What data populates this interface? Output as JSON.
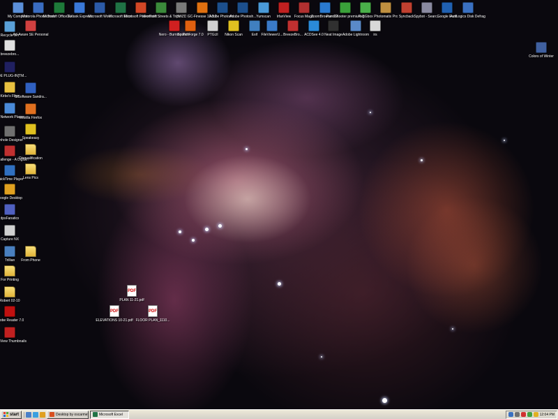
{
  "desktop": {
    "top_row": [
      {
        "name": "icon-my-computer",
        "label": "My Computer",
        "color": "#5b8fd8"
      },
      {
        "name": "icon-motorola-phone-tools",
        "label": "Motorola Phone Tools",
        "color": "#3a6cc0"
      },
      {
        "name": "icon-office-excel-1",
        "label": "Microsoft Office Ex...",
        "color": "#1e7a3a"
      },
      {
        "name": "icon-outlook-express",
        "label": "Outlook Express",
        "color": "#3a78d8"
      },
      {
        "name": "icon-ms-word",
        "label": "Microsoft Word",
        "color": "#2c5aa8"
      },
      {
        "name": "icon-ms-excel",
        "label": "Microsoft Excel",
        "color": "#207245"
      },
      {
        "name": "icon-ms-powerpoint",
        "label": "Microsoft PowerPoint",
        "color": "#d24726"
      },
      {
        "name": "icon-ms-streets-trips",
        "label": "Microsoft Streets & Trips",
        "color": "#3b8a3b"
      },
      {
        "name": "icon-3wzd",
        "label": "3WZD",
        "color": "#7a7a7a"
      },
      {
        "name": "icon-gc-finesse",
        "label": "GC-Finesse 13.2.2",
        "color": "#e07010"
      },
      {
        "name": "icon-adobe-photoshop-1",
        "label": "Adobe Photosh...",
        "color": "#1c4f8c"
      },
      {
        "name": "icon-adobe-photoshop-2",
        "label": "Adobe Photosh...",
        "color": "#1c4f8c"
      },
      {
        "name": "icon-yumscan",
        "label": "Yumscan",
        "color": "#4a9ad8"
      },
      {
        "name": "icon-irfanview",
        "label": "IrfanView",
        "color": "#c02020"
      },
      {
        "name": "icon-focus-magic",
        "label": "Focus Magic",
        "color": "#b03030"
      },
      {
        "name": "icon-zoombrowser",
        "label": "ZoomBrowser EX",
        "color": "#2a7ad0"
      },
      {
        "name": "icon-panoshooter",
        "label": "PanoShooter premium 2006",
        "color": "#3aa03a"
      },
      {
        "name": "icon-regcleaner",
        "label": "RegGbox",
        "color": "#4ab04a"
      },
      {
        "name": "icon-photomatix",
        "label": "Photomatix Pro",
        "color": "#c09040"
      },
      {
        "name": "icon-syncback",
        "label": "Syncback",
        "color": "#c04030"
      },
      {
        "name": "icon-spybot",
        "label": "Spybot - Searc...",
        "color": "#8a8aa0"
      },
      {
        "name": "icon-google-earth",
        "label": "Google Earth",
        "color": "#2060b0"
      },
      {
        "name": "icon-auslogics-defrag",
        "label": "AusLogics Disk Defrag",
        "color": "#3a70c0"
      }
    ],
    "second_row": [
      {
        "name": "icon-nero-burning-rom",
        "label": "Nero - Burning Rom",
        "color": "#d02020"
      },
      {
        "name": "icon-sound-forge",
        "label": "Sound Forge 7.0",
        "color": "#e06010"
      },
      {
        "name": "icon-ptgui",
        "label": "PTGUI",
        "color": "#d0d0d0"
      },
      {
        "name": "icon-nikon-scan",
        "label": "Nikon Scan",
        "color": "#e0c020"
      },
      {
        "name": "icon-exif",
        "label": "Exif",
        "color": "#4080c0"
      },
      {
        "name": "icon-fileviewer",
        "label": "FileViewerU...",
        "color": "#3a7ac8"
      },
      {
        "name": "icon-breezebrowser",
        "label": "BreezeBro...",
        "color": "#c03030"
      },
      {
        "name": "icon-acdsee",
        "label": "ACDSee 4.0",
        "color": "#2a8ad8"
      },
      {
        "name": "icon-neat-image",
        "label": "Neat Image",
        "color": "#303030"
      },
      {
        "name": "icon-adobe-lightroom",
        "label": "Adobe Lightroom",
        "color": "#5a8ac8"
      },
      {
        "name": "icon-irs",
        "label": "irs",
        "color": "#d8d8d8"
      }
    ],
    "left_column_a": [
      {
        "name": "icon-recycle-bin",
        "label": "Recycle Bin",
        "color": "#5aa0d8"
      },
      {
        "name": "icon-breezebro-left",
        "label": "breezebro...",
        "color": "#e0e0e0"
      },
      {
        "name": "icon-slide-plugin",
        "label": "SLIDE PLUG-IN[TM...",
        "color": "#202060"
      },
      {
        "name": "icon-kirbys-files",
        "label": "Kirbo's Files",
        "color": "#e8c040"
      },
      {
        "name": "icon-my-network-places",
        "label": "My Network Places",
        "color": "#4a8ad8"
      },
      {
        "name": "icon-pinhole-designer",
        "label": "Pinhole Designer",
        "color": "#707070"
      },
      {
        "name": "icon-dpchallenge",
        "label": "DPChallenge - A Digital Ph...",
        "color": "#c03030"
      },
      {
        "name": "icon-quicktime",
        "label": "QuickTime Player",
        "color": "#3070c0"
      },
      {
        "name": "icon-google-desktop",
        "label": "Google Desktop",
        "color": "#e0a020"
      },
      {
        "name": "icon-dpsfanatics",
        "label": "dpsFanatics",
        "color": "#5060c0"
      },
      {
        "name": "icon-capture-nx",
        "label": "Capture NX",
        "color": "#d0d0d0"
      },
      {
        "name": "icon-trillian",
        "label": "Trillian",
        "color": "#4a80c0"
      },
      {
        "name": "icon-for-printing",
        "label": "For Printing",
        "folder": true
      },
      {
        "name": "icon-robert",
        "label": "Robert 02-10",
        "folder": true
      },
      {
        "name": "icon-adobe-reader",
        "label": "Adobe Reader 7.0",
        "color": "#c01010"
      },
      {
        "name": "icon-irfanview-thumbnails",
        "label": "IrfanView Thumbnails",
        "color": "#c02020"
      }
    ],
    "left_column_b": [
      {
        "name": "icon-adaware",
        "label": "Ad-Aware SE Personal",
        "color": "#d04040"
      },
      {
        "name": "icon-sisoftware-sandra",
        "label": "SiSoftware Sandra...",
        "color": "#3060c0"
      },
      {
        "name": "icon-mozilla-firefox",
        "label": "Mozilla Firefox",
        "color": "#e07020"
      },
      {
        "name": "icon-speakeasy",
        "label": "Speakeasy",
        "color": "#e0c020"
      },
      {
        "name": "icon-disqualification",
        "label": "Disqualification",
        "folder": true
      },
      {
        "name": "icon-lens-pics",
        "label": "Lens Pics",
        "folder": true
      },
      {
        "name": "icon-from-phone",
        "label": "From Phone",
        "folder": true
      }
    ],
    "right_icon": {
      "name": "icon-colors-of-winter",
      "label": "Colors of Winter",
      "color": "#4060a0"
    },
    "pdf_files": [
      {
        "name": "pdf-plan",
        "label": "PLAN 11-21.pdf",
        "badge": "PDF"
      },
      {
        "name": "pdf-elevations",
        "label": "ELEVATIONS 10-21.pdf",
        "badge": "PDF"
      },
      {
        "name": "pdf-floor-plan",
        "label": "FLOOR PLAN_1110...",
        "badge": "PDF"
      }
    ]
  },
  "taskbar": {
    "start_label": "start",
    "tasks": [
      {
        "label": "Desktop by oscarmeyer -...",
        "color": "#d85020",
        "active": false
      },
      {
        "label": "Microsoft Excel",
        "color": "#207245",
        "active": true
      }
    ],
    "clock": "12:04 PM"
  }
}
